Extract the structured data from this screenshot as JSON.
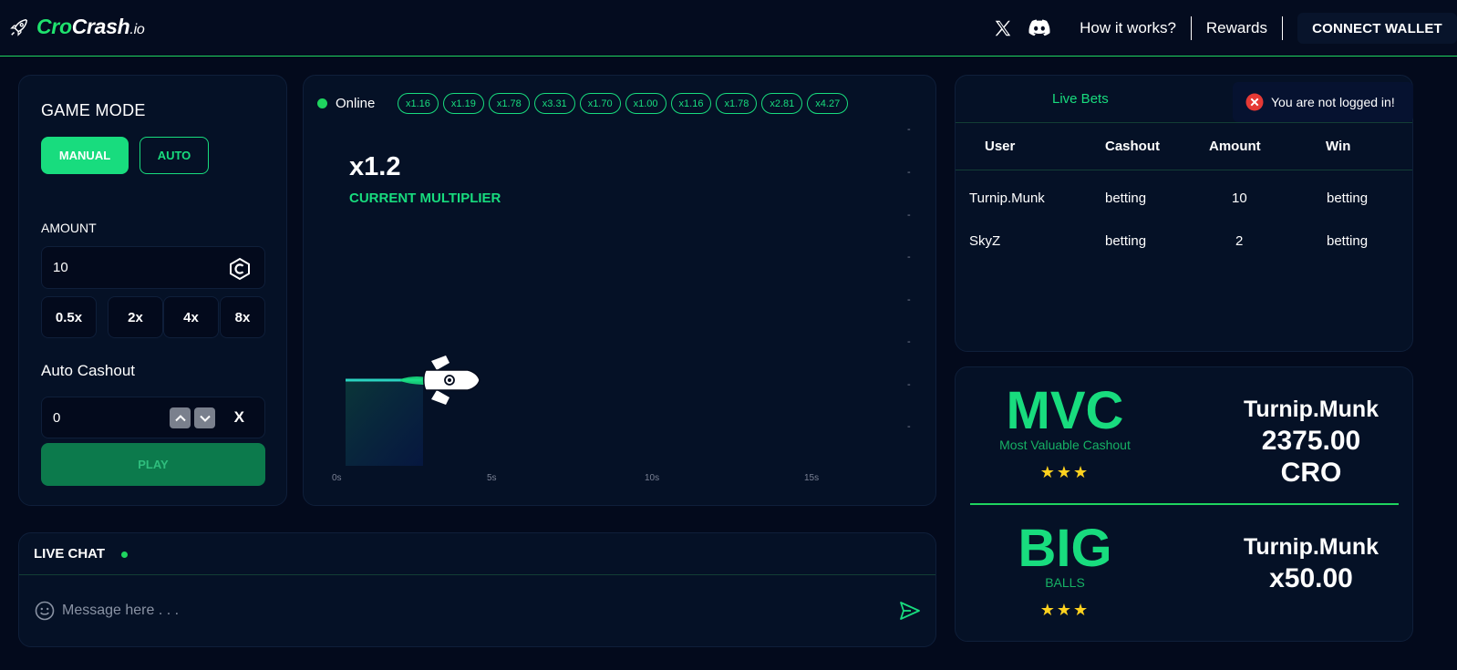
{
  "header": {
    "logo": {
      "cro": "Cro",
      "crash": "Crash",
      "io": ".io"
    },
    "nav": {
      "how_it_works": "How it works?",
      "rewards": "Rewards",
      "connect_wallet": "CONNECT WALLET"
    },
    "icons": [
      "x-icon",
      "discord-icon"
    ]
  },
  "game_mode": {
    "title": "GAME MODE",
    "manual_label": "MANUAL",
    "auto_label": "AUTO",
    "amount_label": "AMOUNT",
    "amount_value": "10",
    "multipliers": [
      "0.5x",
      "2x",
      "4x",
      "8x"
    ],
    "auto_cashout_label": "Auto Cashout",
    "auto_cashout_value": "0",
    "auto_cashout_suffix": "X",
    "play_label": "PLAY"
  },
  "game": {
    "online_label": "Online",
    "history": [
      "x1.16",
      "x1.19",
      "x1.78",
      "x3.31",
      "x1.70",
      "x1.00",
      "x1.16",
      "x1.78",
      "x2.81",
      "x4.27"
    ],
    "current_multiplier": "x1.2",
    "current_multiplier_label": "CURRENT MULTIPLIER",
    "x_ticks": [
      "0s",
      "5s",
      "10s",
      "15s"
    ],
    "y_ticks": [
      "-",
      "-",
      "-",
      "-",
      "-",
      "-",
      "-",
      "-"
    ],
    "accent": "#18dc7e"
  },
  "live_bets": {
    "tab_label": "Live Bets",
    "columns": [
      "User",
      "Cashout",
      "Amount",
      "Win"
    ],
    "rows": [
      {
        "user": "Turnip.Munk",
        "cashout": "betting",
        "amount": "10",
        "win": "betting"
      },
      {
        "user": "SkyZ",
        "cashout": "betting",
        "amount": "2",
        "win": "betting"
      }
    ]
  },
  "toast": {
    "message": "You are not logged in!",
    "color": "#e53935"
  },
  "mvc": {
    "title": "MVC",
    "subtitle": "Most Valuable Cashout",
    "stars": "★★★",
    "user": "Turnip.Munk",
    "amount": "2375.00",
    "currency": "CRO"
  },
  "big": {
    "title": "BIG",
    "subtitle": "BALLS",
    "stars": "★★★",
    "user": "Turnip.Munk",
    "multiplier": "x50.00"
  },
  "chat": {
    "title": "LIVE CHAT",
    "placeholder": "Message here . . ."
  }
}
